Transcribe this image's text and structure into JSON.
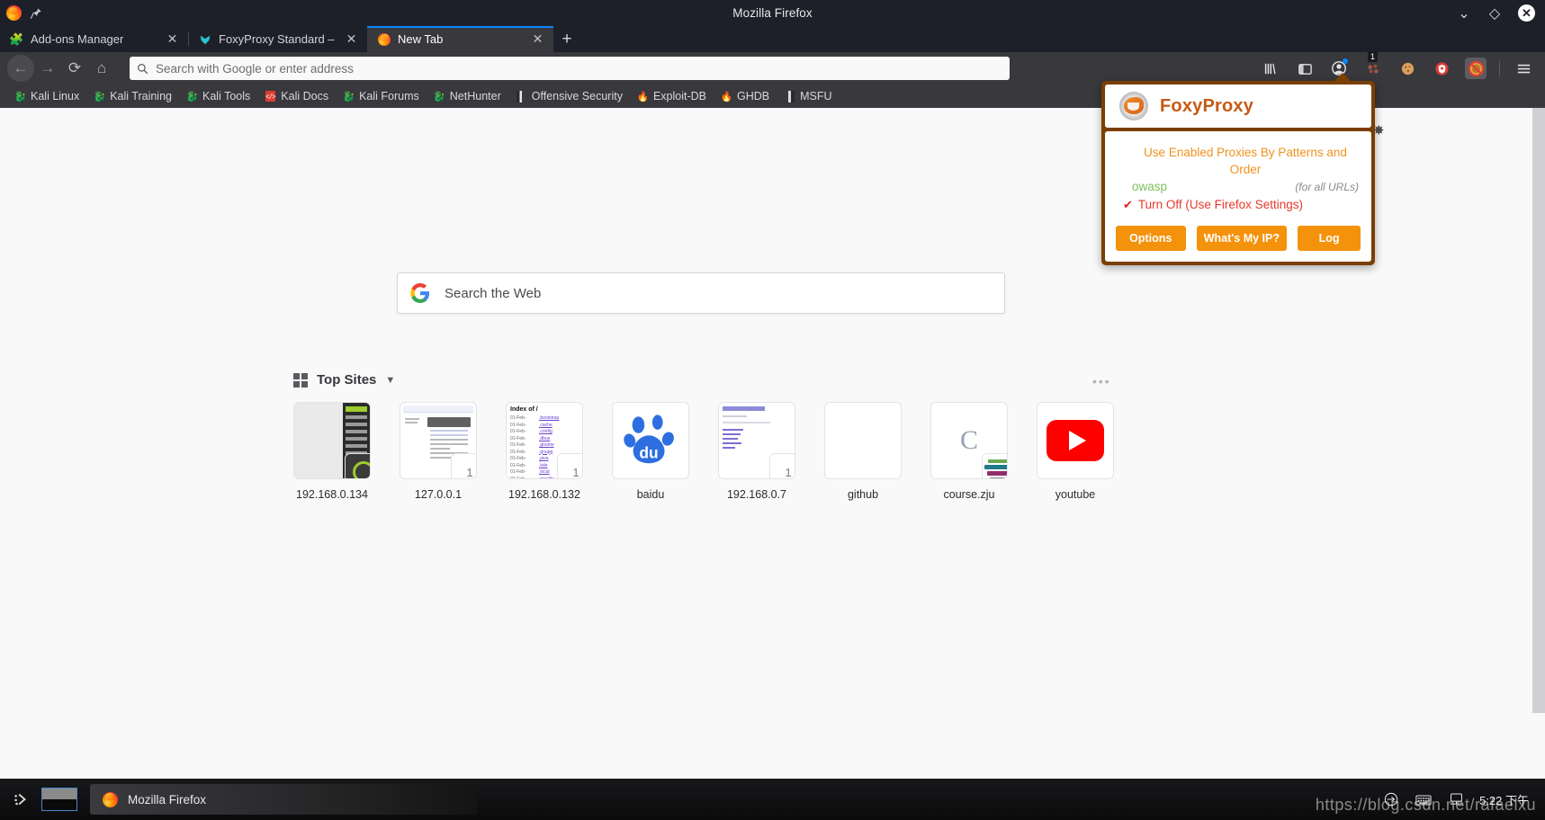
{
  "window": {
    "title": "Mozilla Firefox",
    "controls": {
      "minimize": "⌄",
      "maximize": "◇",
      "close": "✕"
    }
  },
  "tabs": [
    {
      "label": "Add-ons Manager",
      "icon": "puzzle-icon",
      "close": "✕",
      "active": false
    },
    {
      "label": "FoxyProxy Standard – Get",
      "icon": "foxyproxy-addon-icon",
      "close": "✕",
      "active": false
    },
    {
      "label": "New Tab",
      "icon": "firefox-icon",
      "close": "✕",
      "active": true
    }
  ],
  "new_tab_button": "+",
  "nav": {
    "back": "←",
    "forward": "→",
    "reload": "⟳",
    "home": "⌂",
    "urlbar_placeholder": "Search with Google or enter address",
    "urlbar_value": "",
    "search_icon": "magnifier-icon",
    "icons": [
      {
        "name": "library-icon",
        "glyph": "|||\\"
      },
      {
        "name": "sidebar-icon",
        "glyph": "▥"
      },
      {
        "name": "account-icon",
        "glyph": "◕"
      },
      {
        "name": "extension-dots-icon",
        "glyph": "⁘",
        "badge": "1"
      },
      {
        "name": "cookie-icon",
        "glyph": "🍪"
      },
      {
        "name": "shield-red-icon",
        "glyph": "⛨"
      },
      {
        "name": "foxyproxy-toolbar-icon",
        "glyph": "⊘"
      },
      {
        "name": "hamburger-menu-icon",
        "glyph": "☰"
      }
    ]
  },
  "bookmarks": [
    {
      "label": "Kali Linux",
      "icon": "kali-dragon-icon"
    },
    {
      "label": "Kali Training",
      "icon": "kali-dragon-icon"
    },
    {
      "label": "Kali Tools",
      "icon": "kali-dragon-icon"
    },
    {
      "label": "Kali Docs",
      "icon": "kali-docs-icon"
    },
    {
      "label": "Kali Forums",
      "icon": "kali-dragon-icon"
    },
    {
      "label": "NetHunter",
      "icon": "kali-dragon-icon"
    },
    {
      "label": "Offensive Security",
      "icon": "offsec-icon"
    },
    {
      "label": "Exploit-DB",
      "icon": "exploitdb-icon"
    },
    {
      "label": "GHDB",
      "icon": "ghdb-icon"
    },
    {
      "label": "MSFU",
      "icon": "msfu-icon"
    }
  ],
  "newtab": {
    "search": {
      "placeholder": "Search the Web",
      "engine_icon": "google-icon",
      "go_icon": "arrow-right-icon"
    },
    "topsites": {
      "title": "Top Sites",
      "collapse_icon": "chevron-down-icon",
      "grid_icon": "grid-icon",
      "menu_icon": "ellipsis-icon",
      "tiles": [
        {
          "label": "192.168.0.134",
          "badge": ""
        },
        {
          "label": "127.0.0.1",
          "badge": "1"
        },
        {
          "label": "192.168.0.132",
          "badge": "1"
        },
        {
          "label": "baidu",
          "badge": ""
        },
        {
          "label": "192.168.0.7",
          "badge": "1"
        },
        {
          "label": "github",
          "badge": ""
        },
        {
          "label": "course.zju",
          "badge": ""
        },
        {
          "label": "youtube",
          "badge": ""
        }
      ]
    }
  },
  "foxyproxy": {
    "title": "FoxyProxy",
    "logo_icon": "foxyproxy-logo-icon",
    "modes": [
      {
        "label": "Use Enabled Proxies By Patterns and Order",
        "color": "#f0921e",
        "checked": false
      },
      {
        "label": "owasp",
        "note": "(for all URLs)",
        "color": "#7fbf5c",
        "checked": false
      },
      {
        "label": "Turn Off (Use Firefox Settings)",
        "color": "#e8382a",
        "checked": true,
        "check_glyph": "✔"
      }
    ],
    "buttons": [
      {
        "label": "Options",
        "name": "options-button"
      },
      {
        "label": "What's My IP?",
        "name": "whats-my-ip-button"
      },
      {
        "label": "Log",
        "name": "log-button"
      }
    ],
    "accent": "#f4920b",
    "border": "#7b3f00"
  },
  "taskbar": {
    "menu_icon": "kde-menu-icon",
    "pager_icon": "pager-icon",
    "task": {
      "label": "Mozilla Firefox",
      "icon": "firefox-icon"
    },
    "tray": [
      {
        "name": "network-icon",
        "glyph": "⇄"
      },
      {
        "name": "keyboard-icon",
        "glyph": "⌨"
      },
      {
        "name": "display-icon",
        "glyph": "🖳"
      }
    ],
    "clock": "5:22 下午"
  },
  "watermark": "https://blog.csdn.net/rafaelxu"
}
